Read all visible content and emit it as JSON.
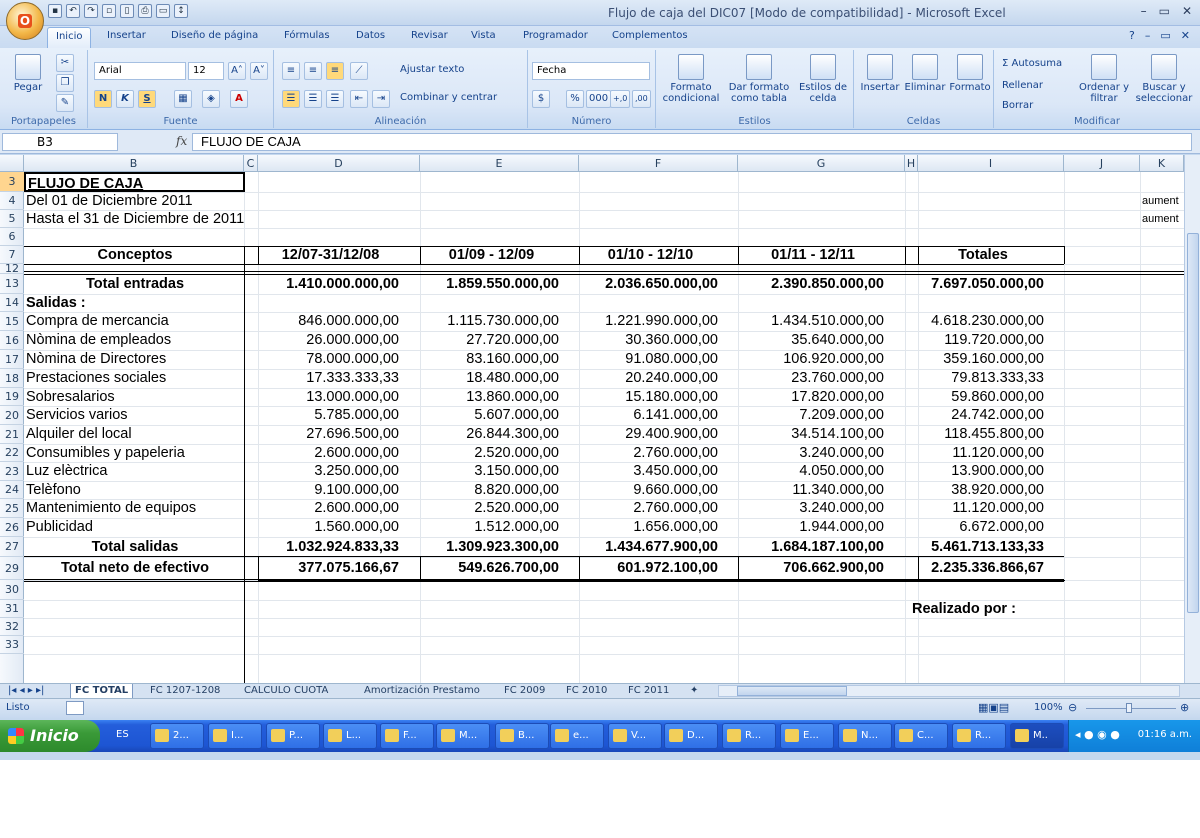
{
  "window": {
    "title": "Flujo de caja del DIC07  [Modo de compatibilidad] - Microsoft Excel",
    "minimize": "–",
    "restore": "▭",
    "close": "✕"
  },
  "office_button": "O",
  "tabs": [
    "Inicio",
    "Insertar",
    "Diseño de página",
    "Fórmulas",
    "Datos",
    "Revisar",
    "Vista",
    "Programador",
    "Complementos"
  ],
  "ribbon": {
    "portapapeles": {
      "label": "Portapapeles",
      "paste": "Pegar"
    },
    "fuente": {
      "label": "Fuente",
      "font_name": "Arial",
      "font_size": "12",
      "grow": "A˄",
      "shrink": "A˅",
      "bold": "N",
      "italic": "K",
      "underline": "S"
    },
    "alineacion": {
      "label": "Alineación",
      "wrap": "Ajustar texto",
      "merge": "Combinar y centrar"
    },
    "numero": {
      "label": "Número",
      "format": "Fecha",
      "percent": "%",
      "thousands": "000",
      "inc_dec": "+,0",
      "dec_dec": ",00"
    },
    "estilos": {
      "label": "Estilos",
      "conditional": "Formato condicional",
      "as_table": "Dar formato como tabla",
      "cell_styles": "Estilos de celda"
    },
    "celdas": {
      "label": "Celdas",
      "insert": "Insertar",
      "delete": "Eliminar",
      "format": "Formato"
    },
    "modificar": {
      "label": "Modificar",
      "autosum": "Σ Autosuma",
      "fill": "Rellenar",
      "clear": "Borrar",
      "sort": "Ordenar y filtrar",
      "find": "Buscar y seleccionar"
    }
  },
  "formula_bar": {
    "name_box": "B3",
    "fx": "fx",
    "formula": "FLUJO DE CAJA"
  },
  "columns": [
    "B",
    "C",
    "D",
    "E",
    "F",
    "G",
    "H",
    "I",
    "J",
    "K"
  ],
  "rows": [
    "3",
    "4",
    "5",
    "6",
    "7",
    "12",
    "13",
    "14",
    "15",
    "16",
    "17",
    "18",
    "19",
    "20",
    "21",
    "22",
    "23",
    "24",
    "25",
    "26",
    "27",
    "29",
    "30",
    "31",
    "32",
    "33"
  ],
  "sheet": {
    "title": "FLUJO DE CAJA",
    "from": "Del 01 de Diciembre 2011",
    "to": "Hasta el 31 de Diciembre de 2011",
    "k4": "aument",
    "k5": "aument",
    "header": [
      "Conceptos",
      "12/07-31/12/08",
      "01/09 - 12/09",
      "01/10 - 12/10",
      "01/11 - 12/11",
      "Totales"
    ],
    "total_entradas": {
      "label": "Total entradas",
      "values": [
        "1.410.000.000,00",
        "1.859.550.000,00",
        "2.036.650.000,00",
        "2.390.850.000,00",
        "7.697.050.000,00"
      ]
    },
    "salidas_label": "Salidas :",
    "salidas": [
      {
        "concept": "Compra de mercancia",
        "values": [
          "846.000.000,00",
          "1.115.730.000,00",
          "1.221.990.000,00",
          "1.434.510.000,00",
          "4.618.230.000,00"
        ]
      },
      {
        "concept": "Nòmina de empleados",
        "values": [
          "26.000.000,00",
          "27.720.000,00",
          "30.360.000,00",
          "35.640.000,00",
          "119.720.000,00"
        ]
      },
      {
        "concept": "Nòmina de Directores",
        "values": [
          "78.000.000,00",
          "83.160.000,00",
          "91.080.000,00",
          "106.920.000,00",
          "359.160.000,00"
        ]
      },
      {
        "concept": "Prestaciones sociales",
        "values": [
          "17.333.333,33",
          "18.480.000,00",
          "20.240.000,00",
          "23.760.000,00",
          "79.813.333,33"
        ]
      },
      {
        "concept": "Sobresalarios",
        "values": [
          "13.000.000,00",
          "13.860.000,00",
          "15.180.000,00",
          "17.820.000,00",
          "59.860.000,00"
        ]
      },
      {
        "concept": "Servicios varios",
        "values": [
          "5.785.000,00",
          "5.607.000,00",
          "6.141.000,00",
          "7.209.000,00",
          "24.742.000,00"
        ]
      },
      {
        "concept": "Alquiler del local",
        "values": [
          "27.696.500,00",
          "26.844.300,00",
          "29.400.900,00",
          "34.514.100,00",
          "118.455.800,00"
        ]
      },
      {
        "concept": "Consumibles y papeleria",
        "values": [
          "2.600.000,00",
          "2.520.000,00",
          "2.760.000,00",
          "3.240.000,00",
          "11.120.000,00"
        ]
      },
      {
        "concept": "Luz elèctrica",
        "values": [
          "3.250.000,00",
          "3.150.000,00",
          "3.450.000,00",
          "4.050.000,00",
          "13.900.000,00"
        ]
      },
      {
        "concept": "Telèfono",
        "values": [
          "9.100.000,00",
          "8.820.000,00",
          "9.660.000,00",
          "11.340.000,00",
          "38.920.000,00"
        ]
      },
      {
        "concept": "Mantenimiento de equipos",
        "values": [
          "2.600.000,00",
          "2.520.000,00",
          "2.760.000,00",
          "3.240.000,00",
          "11.120.000,00"
        ]
      },
      {
        "concept": "Publicidad",
        "values": [
          "1.560.000,00",
          "1.512.000,00",
          "1.656.000,00",
          "1.944.000,00",
          "6.672.000,00"
        ]
      }
    ],
    "total_salidas": {
      "label": "Total salidas",
      "values": [
        "1.032.924.833,33",
        "1.309.923.300,00",
        "1.434.677.900,00",
        "1.684.187.100,00",
        "5.461.713.133,33"
      ]
    },
    "total_neto": {
      "label": "Total neto de efectivo",
      "values": [
        "377.075.166,67",
        "549.626.700,00",
        "601.972.100,00",
        "706.662.900,00",
        "2.235.336.866,67"
      ]
    },
    "realizado": "Realizado por :"
  },
  "sheet_tabs": [
    "FC TOTAL",
    "FC 1207-1208",
    "CALCULO  CUOTA",
    "Amortización Prestamo",
    "FC 2009",
    "FC 2010",
    "FC 2011"
  ],
  "status": {
    "text": "Listo",
    "zoom": "100%"
  },
  "taskbar": {
    "start": "Inicio",
    "lang": "ES",
    "buttons": [
      "2...",
      "I...",
      "P...",
      "L...",
      "F...",
      "M...",
      "B...",
      "e...",
      "V...",
      "D...",
      "R...",
      "E...",
      "N...",
      "C...",
      "R...",
      "M.."
    ],
    "clock": "01:16 a.m."
  }
}
